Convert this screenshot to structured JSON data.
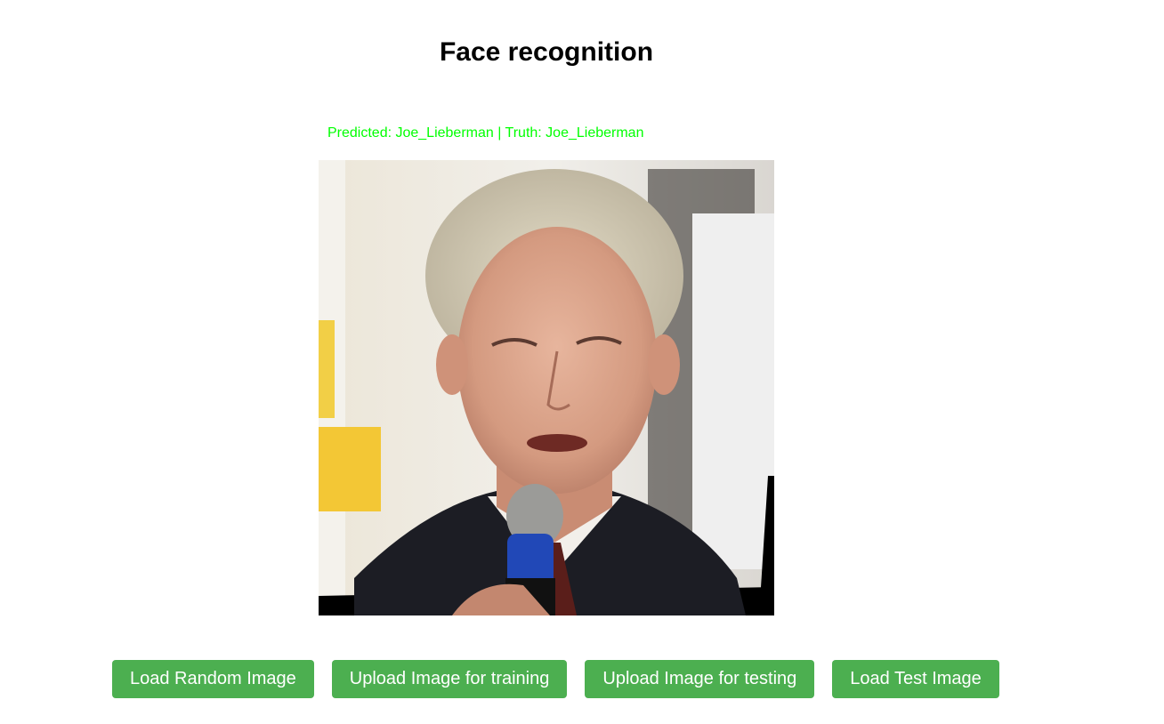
{
  "header": {
    "title": "Face recognition"
  },
  "result": {
    "prediction_text": "Predicted: Joe_Lieberman | Truth: Joe_Lieberman",
    "status_color": "#00ff00"
  },
  "image": {
    "subject": "face photo of a man speaking into a microphone"
  },
  "actions": {
    "load_random_label": "Load Random Image",
    "upload_training_label": "Upload Image for training",
    "upload_testing_label": "Upload Image for testing",
    "load_test_label": "Load Test Image",
    "button_color": "#4caf50"
  }
}
